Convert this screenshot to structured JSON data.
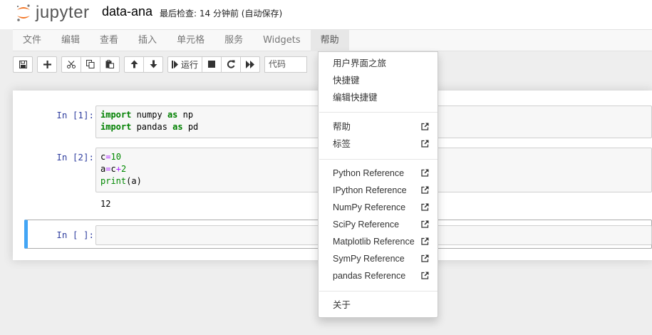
{
  "header": {
    "logo_text": "jupyter",
    "notebook_name": "data-ana",
    "checkpoint": "最后检查: 14 分钟前  (自动保存)"
  },
  "menubar": {
    "items": [
      {
        "label": "文件"
      },
      {
        "label": "编辑"
      },
      {
        "label": "查看"
      },
      {
        "label": "插入"
      },
      {
        "label": "单元格"
      },
      {
        "label": "服务"
      },
      {
        "label": "Widgets"
      },
      {
        "label": "帮助"
      }
    ],
    "active_index": 7
  },
  "toolbar": {
    "run_label": "运行",
    "cell_type": "代码"
  },
  "cells": [
    {
      "prompt": "In  [1]:",
      "lines": [
        [
          {
            "t": "import",
            "k": "kw"
          },
          {
            "t": " numpy ",
            "k": ""
          },
          {
            "t": "as",
            "k": "kw"
          },
          {
            "t": " np",
            "k": ""
          }
        ],
        [
          {
            "t": "import",
            "k": "kw"
          },
          {
            "t": " pandas ",
            "k": ""
          },
          {
            "t": "as",
            "k": "kw"
          },
          {
            "t": " pd",
            "k": ""
          }
        ]
      ]
    },
    {
      "prompt": "In  [2]:",
      "lines": [
        [
          {
            "t": "c",
            "k": ""
          },
          {
            "t": "=",
            "k": "op"
          },
          {
            "t": "10",
            "k": "num"
          }
        ],
        [
          {
            "t": "a",
            "k": ""
          },
          {
            "t": "=",
            "k": "op"
          },
          {
            "t": "c",
            "k": ""
          },
          {
            "t": "+",
            "k": "op"
          },
          {
            "t": "2",
            "k": "num"
          }
        ],
        [
          {
            "t": "print",
            "k": "num"
          },
          {
            "t": "(a)",
            "k": ""
          }
        ]
      ],
      "output": "12"
    },
    {
      "prompt": "In  [ ]:"
    }
  ],
  "help_menu": {
    "group1": [
      "用户界面之旅",
      "快捷键",
      "编辑快捷键"
    ],
    "group2": [
      "帮助",
      "标签"
    ],
    "group3": [
      "Python Reference",
      "IPython Reference",
      "NumPy Reference",
      "SciPy Reference",
      "Matplotlib Reference",
      "SymPy Reference",
      "pandas Reference"
    ],
    "group4": [
      "关于"
    ]
  },
  "colors": {
    "accent": "#42a5f5",
    "prompt": "#303f9f",
    "logo_orange": "#f37626"
  }
}
